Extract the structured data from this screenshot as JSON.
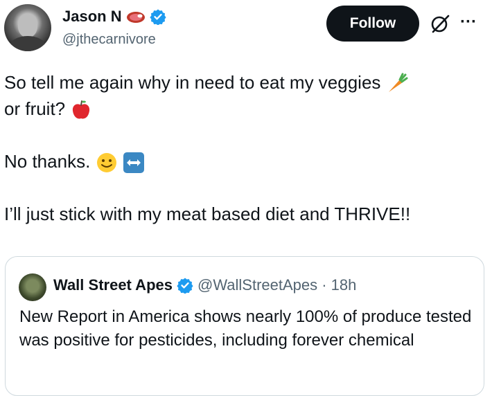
{
  "author": {
    "name": "Jason N",
    "handle": "@jthecarnivore",
    "name_emoji": "steak",
    "verified": true
  },
  "actions": {
    "follow_label": "Follow",
    "grok_icon": "grok-icon",
    "more_icon": "more-icon"
  },
  "tweet": {
    "line1": "So tell me again why in need to eat my veggies",
    "line2": "or fruit?",
    "line3": "No thanks.",
    "line4": "I’ll just stick with my meat based diet and THRIVE!!"
  },
  "quote": {
    "name": "Wall Street Apes",
    "handle_time": "@WallStreetApes · 18h",
    "verified": true,
    "text": "New Report in America shows nearly 100% of produce tested was positive for pesticides, including forever chemical"
  },
  "colors": {
    "text": "#0f1419",
    "secondary": "#536471",
    "verified": "#1d9bf0",
    "follow_bg": "#0f1419",
    "border": "#cfd9de"
  }
}
